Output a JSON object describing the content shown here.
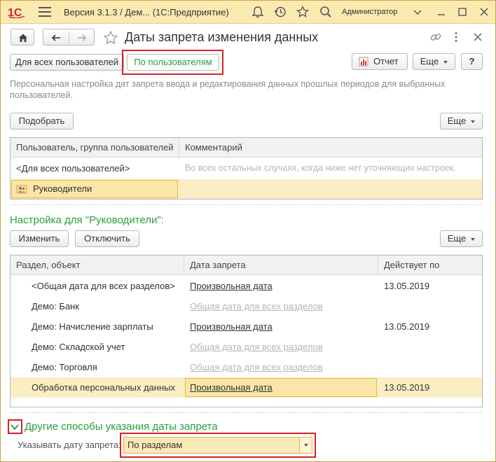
{
  "titlebar": {
    "app_title": "Версия 3.1.3 / Дем...   (1С:Предприятие)",
    "user": "Администратор"
  },
  "header": {
    "title": "Даты запрета изменения данных",
    "btn_all_users": "Для всех пользователей",
    "btn_by_users": "По пользователям",
    "btn_report": "Отчет",
    "btn_more": "Еще",
    "btn_help": "?"
  },
  "description": "Персональная настройка дат запрета ввода и редактирования данных прошлых периодов для выбранных пользователей.",
  "users_panel": {
    "btn_pick": "Подобрать",
    "btn_more": "Еще",
    "columns": [
      "Пользователь, группа пользователей",
      "Комментарий"
    ],
    "rows": [
      {
        "user": "<Для всех пользователей>",
        "comment": "Во всех остальных случаях, когда ниже нет уточняющих настроек."
      },
      {
        "user": "Руководители",
        "comment": ""
      }
    ]
  },
  "settings_panel": {
    "heading": "Настройка для \"Руководители\":",
    "btn_change": "Изменить",
    "btn_disable": "Отключить",
    "btn_more": "Еще",
    "columns": [
      "Раздел, объект",
      "Дата запрета",
      "Действует по"
    ],
    "rows": [
      {
        "section": "<Общая дата для всех разделов>",
        "date": "Произвольная дата",
        "until": "13.05.2019"
      },
      {
        "section": "Демо: Банк",
        "date": "Общая дата для всех разделов",
        "until": ""
      },
      {
        "section": "Демо: Начисление зарплаты",
        "date": "Произвольная дата",
        "until": "13.05.2019"
      },
      {
        "section": "Демо: Складской учет",
        "date": "Общая дата для всех разделов",
        "until": ""
      },
      {
        "section": "Демо: Торговля",
        "date": "Общая дата для всех разделов",
        "until": ""
      },
      {
        "section": "Обработка персональных данных",
        "date": "Произвольная дата",
        "until": "13.05.2019"
      }
    ]
  },
  "other_ways": {
    "title": "Другие способы указания даты запрета",
    "label": "Указывать дату запрета:",
    "value": "По разделам"
  },
  "colors": {
    "accent_green": "#2d9c3c",
    "highlight": "#fbeec5",
    "titlebar": "#fbeab0",
    "annotation_red": "#d81f2a"
  },
  "icons": [
    "1c-logo-icon",
    "menu-icon",
    "bell-icon",
    "history-icon",
    "star-icon",
    "search-icon",
    "home-icon",
    "back-arrow-icon",
    "forward-arrow-icon",
    "link-icon",
    "close-icon",
    "report-icon",
    "user-group-icon",
    "chevron-down-icon"
  ]
}
